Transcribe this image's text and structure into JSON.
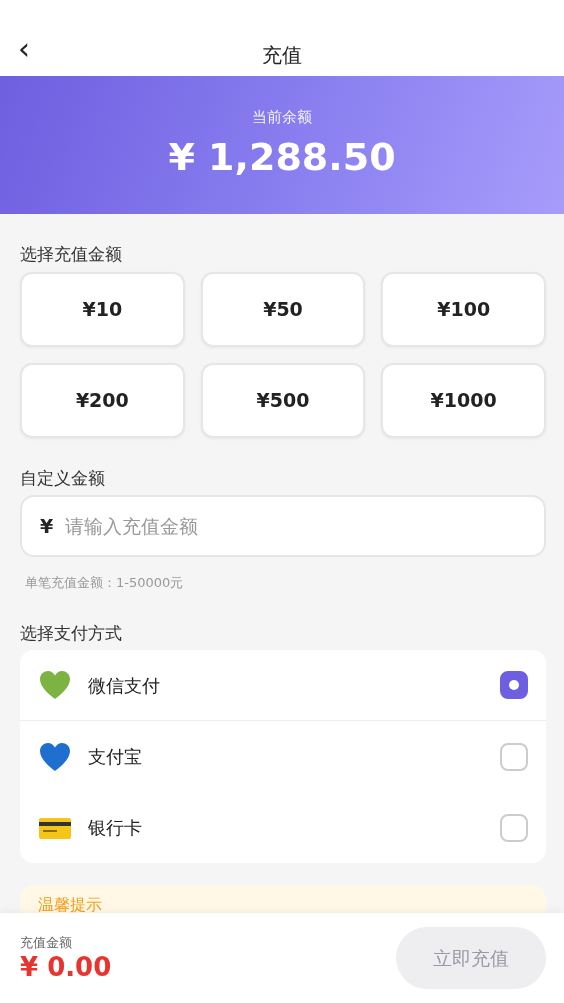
{
  "header": {
    "back": "‹",
    "title": "充值"
  },
  "balance": {
    "label": "当前余额",
    "amount": "¥ 1,288.50"
  },
  "amount_section": {
    "title": "选择充值金额",
    "options": [
      {
        "label": "¥10",
        "selected": false
      },
      {
        "label": "¥50",
        "selected": false
      },
      {
        "label": "¥100",
        "selected": false
      },
      {
        "label": "¥200",
        "selected": false
      },
      {
        "label": "¥500",
        "selected": false
      },
      {
        "label": "¥1000",
        "selected": false
      }
    ]
  },
  "custom_amount": {
    "title": "自定义金额",
    "currency": "¥",
    "placeholder": "请输入充值金额",
    "hint": "单笔充值金额：1-50000元"
  },
  "payment": {
    "title": "选择支付方式",
    "methods": [
      {
        "kind": "green-heart",
        "label": "微信支付",
        "selected": true
      },
      {
        "kind": "blue-heart",
        "label": "支付宝",
        "selected": false
      },
      {
        "kind": "card",
        "label": "银行卡",
        "selected": false
      }
    ]
  },
  "tips": {
    "title": "温馨提示"
  },
  "footer": {
    "label": "充值金额",
    "amount": "¥ 0.00",
    "button": "立即充值",
    "disabled": true
  }
}
